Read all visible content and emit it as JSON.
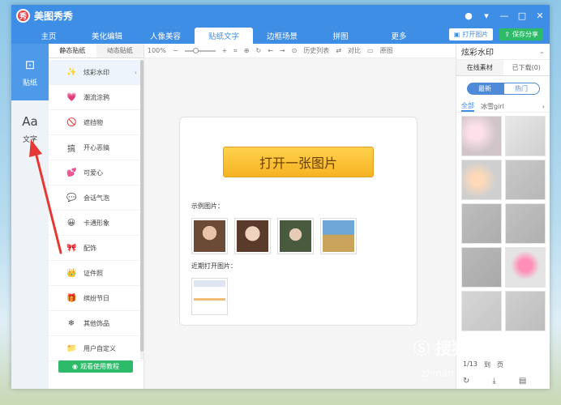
{
  "app": {
    "logo": "秀",
    "title": "美图秀秀"
  },
  "title_controls": [
    "●",
    "▾",
    "—",
    "□",
    "✕"
  ],
  "nav": {
    "tabs": [
      "主页",
      "美化编辑",
      "人像美容",
      "贴纸文字",
      "边框场景",
      "拼图",
      "更多"
    ],
    "active_index": 3,
    "open_image": "打开图片",
    "save_share": "保存分享"
  },
  "left_rail": {
    "sticker": "贴纸",
    "text": "文字"
  },
  "category_tabs": [
    "静态贴纸",
    "动态贴纸"
  ],
  "categories": [
    {
      "icon": "✨",
      "label": "炫彩水印",
      "active": true
    },
    {
      "icon": "💗",
      "label": "潮流涂鸦"
    },
    {
      "icon": "🚫",
      "label": "遮挡物"
    },
    {
      "icon": "搞",
      "label": "开心恶搞"
    },
    {
      "icon": "💕",
      "label": "可爱心"
    },
    {
      "icon": "💬",
      "label": "会话气泡"
    },
    {
      "icon": "😀",
      "label": "卡通形象"
    },
    {
      "icon": "🎀",
      "label": "配饰"
    },
    {
      "icon": "👑",
      "label": "证件照"
    },
    {
      "icon": "🎁",
      "label": "缤纷节日"
    },
    {
      "icon": "❄",
      "label": "其他饰品"
    },
    {
      "icon": "📁",
      "label": "用户自定义"
    }
  ],
  "tutorial_button": "观看使用教程",
  "toolbar": {
    "zoom": "100%",
    "history": "历史列表",
    "compare": "对比",
    "original": "原图"
  },
  "canvas": {
    "open_button": "打开一张图片",
    "sample_label": "示例图片：",
    "recent_label": "近期打开图片："
  },
  "right_panel": {
    "header": "炫彩水印",
    "tabs": [
      "在线素材",
      "已下载(0)"
    ],
    "pills": [
      "最新",
      "热门"
    ],
    "sub_tabs": [
      "全部",
      "冰雪girl"
    ],
    "pager": "1/13",
    "pager_next": "到",
    "pager_page": "页"
  },
  "watermark": {
    "main": "Ⓢ 搜狗指南",
    "sub": "zhinan.sogou.com"
  },
  "colors": {
    "accent": "#3f8ee6",
    "save": "#2dbb6a",
    "open_button": "#f6b323",
    "arrow": "#e53935"
  }
}
